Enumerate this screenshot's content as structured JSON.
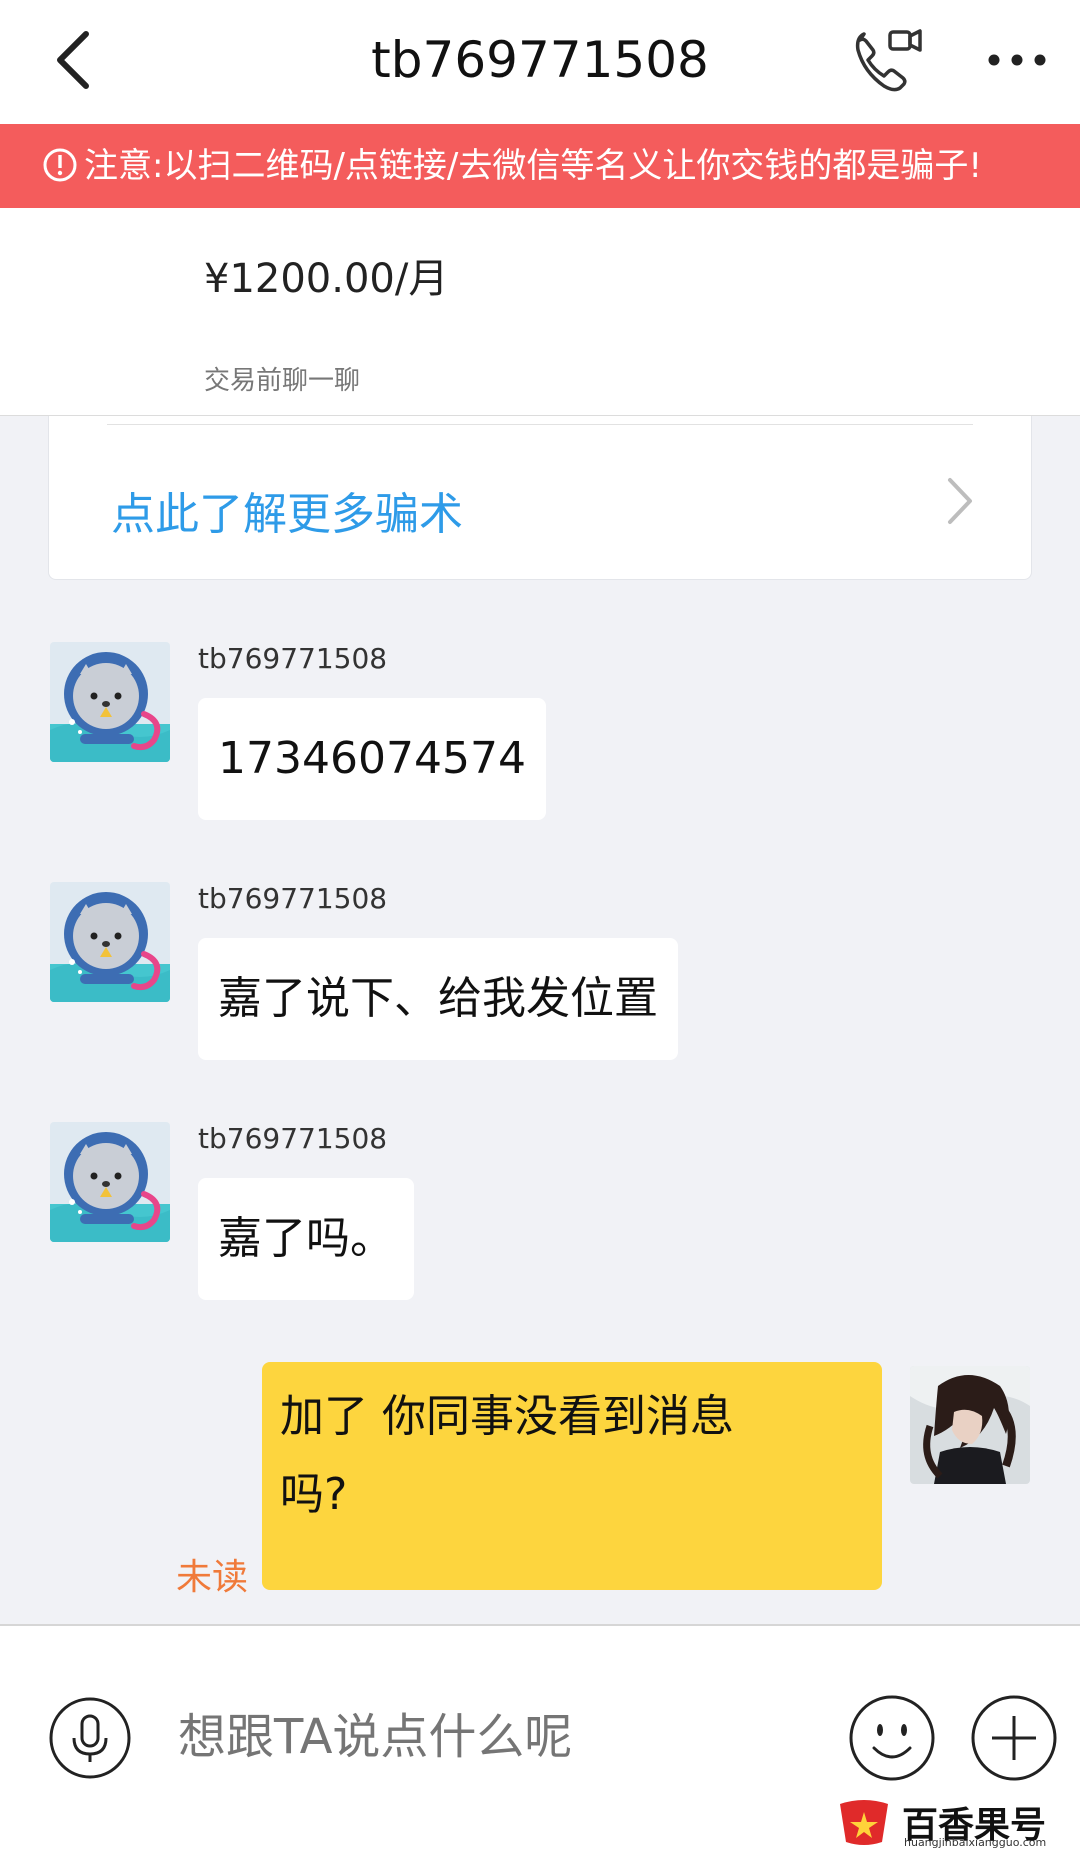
{
  "header": {
    "title": "tb769771508"
  },
  "warning": {
    "text": "注意:以扫二维码/点链接/去微信等名义让你交钱的都是骗子!"
  },
  "product": {
    "price": "¥1200.00/月",
    "chat_before": "交易前聊一聊"
  },
  "tips": {
    "link_text": "点此了解更多骗术"
  },
  "messages": [
    {
      "sender": "tb769771508",
      "text": "17346074574"
    },
    {
      "sender": "tb769771508",
      "text": "嘉了说下、给我发位置"
    },
    {
      "sender": "tb769771508",
      "text": "嘉了吗。"
    }
  ],
  "self_message": {
    "line1": "加了 你同事没看到消息",
    "line2": "吗?",
    "status": "未读"
  },
  "input": {
    "placeholder": "想跟TA说点什么呢"
  },
  "watermark": {
    "name": "百香果号",
    "domain": "huangjinbaixiangguo.com"
  },
  "colors": {
    "warning_bg": "#f45c5c",
    "link": "#2e9be8",
    "self_bubble": "#fdd53e",
    "unread": "#f07a3a",
    "background": "#f1f2f6"
  }
}
